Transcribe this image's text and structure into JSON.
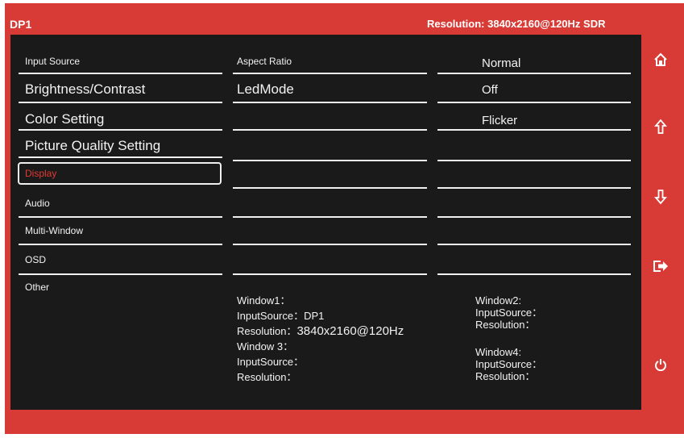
{
  "header": {
    "title": "DP1",
    "resolution": "Resolution: 3840x2160@120Hz  SDR"
  },
  "menu": {
    "col1": [
      "Input Source",
      "Brightness/Contrast",
      "Color Setting",
      "Picture Quality Setting",
      "Display",
      "Audio",
      "Multi-Window",
      "OSD",
      "Other"
    ],
    "col2": [
      "Aspect Ratio",
      "LedMode"
    ],
    "col3": [
      "Normal",
      "Off",
      "Flicker"
    ]
  },
  "windows": {
    "w1_label": "Window1：",
    "w1_input": "InputSource：DP1",
    "w1_res_label": "Resolution：",
    "w1_res_value": "3840x2160@120Hz",
    "w3_label": "Window 3：",
    "w3_input": "InputSource：",
    "w3_res": "Resolution：",
    "w2_label": "Window2:",
    "w2_input": "InputSource：",
    "w2_res": "Resolution：",
    "w4_label": "Window4:",
    "w4_input": "InputSource：",
    "w4_res": "Resolution："
  },
  "sidebar": {
    "icons": [
      "home-icon",
      "arrow-up-icon",
      "arrow-down-icon",
      "exit-icon",
      "power-icon"
    ]
  },
  "colors": {
    "frame": "#d83b35",
    "panel": "#1a1a1a",
    "selected": "#e23a34"
  }
}
